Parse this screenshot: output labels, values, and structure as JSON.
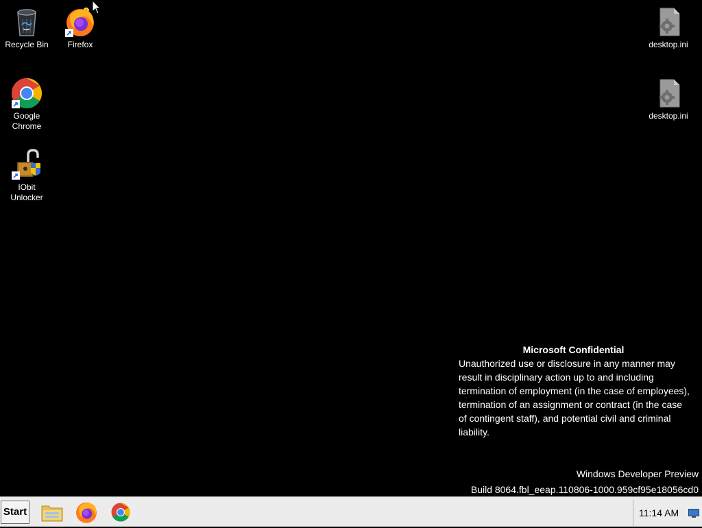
{
  "desktop": {
    "icons": [
      {
        "label": "Recycle Bin",
        "icon": "recycle-bin-icon"
      },
      {
        "label": "Firefox",
        "icon": "firefox-icon"
      },
      {
        "label": "Google Chrome",
        "icon": "chrome-icon"
      },
      {
        "label": "IObit Unlocker",
        "icon": "iobit-unlocker-icon"
      },
      {
        "label": "desktop.ini",
        "icon": "settings-file-icon"
      },
      {
        "label": "desktop.ini",
        "icon": "settings-file-icon"
      }
    ]
  },
  "watermark": {
    "title": "Microsoft Confidential",
    "body": "Unauthorized use or disclosure in any manner may result in disciplinary action up to and including termination of employment (in the case of employees), termination of an assignment or contract (in the case of contingent staff), and potential civil and criminal liability."
  },
  "build": {
    "edition": "Windows Developer Preview",
    "number": "Build 8064.fbl_eeap.110806-1000.959cf95e18056cd0"
  },
  "taskbar": {
    "start_label": "Start",
    "pinned": [
      {
        "icon": "file-explorer-icon"
      },
      {
        "icon": "firefox-icon"
      },
      {
        "icon": "chrome-icon"
      }
    ],
    "clock": "11:14 AM"
  },
  "colors": {
    "desktop_bg": "#000000",
    "taskbar_bg": "#ececec",
    "text": "#ffffff"
  }
}
